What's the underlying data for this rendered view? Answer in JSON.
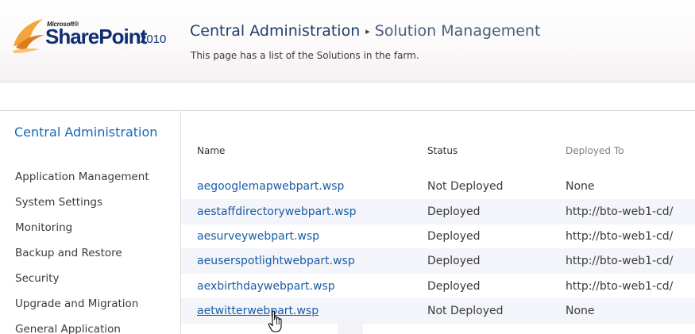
{
  "header": {
    "logo": {
      "microsoft": "Microsoft®",
      "product": "SharePoint",
      "version": "2010"
    },
    "breadcrumb": {
      "root": "Central Administration",
      "separator": "▸",
      "current": "Solution Management"
    },
    "description": "This page has a list of the Solutions in the farm."
  },
  "leftnav": {
    "heading": "Central Administration",
    "items": [
      "Application Management",
      "System Settings",
      "Monitoring",
      "Backup and Restore",
      "Security",
      "Upgrade and Migration",
      "General Application"
    ]
  },
  "table": {
    "columns": {
      "name": "Name",
      "status": "Status",
      "deployed_to": "Deployed To"
    },
    "rows": [
      {
        "name": "aegooglemapwebpart.wsp",
        "status": "Not Deployed",
        "deployed_to": "None"
      },
      {
        "name": "aestaffdirectorywebpart.wsp",
        "status": "Deployed",
        "deployed_to": "http://bto-web1-cd/"
      },
      {
        "name": "aesurveywebpart.wsp",
        "status": "Deployed",
        "deployed_to": "http://bto-web1-cd/"
      },
      {
        "name": "aeuserspotlightwebpart.wsp",
        "status": "Deployed",
        "deployed_to": "http://bto-web1-cd/"
      },
      {
        "name": "aexbirthdaywebpart.wsp",
        "status": "Deployed",
        "deployed_to": "http://bto-web1-cd/"
      },
      {
        "name": "aetwitterwebpart.wsp",
        "status": "Not Deployed",
        "deployed_to": "None"
      }
    ]
  },
  "colors": {
    "link": "#1b5ca5",
    "nav_heading": "#1667b8",
    "title": "#2f4d72",
    "row_alt": "#f3f5fa"
  },
  "icons": {
    "logo": "sharepoint-logo-icon",
    "separator": "breadcrumb-arrow-icon",
    "cursor": "hand-cursor-icon"
  }
}
